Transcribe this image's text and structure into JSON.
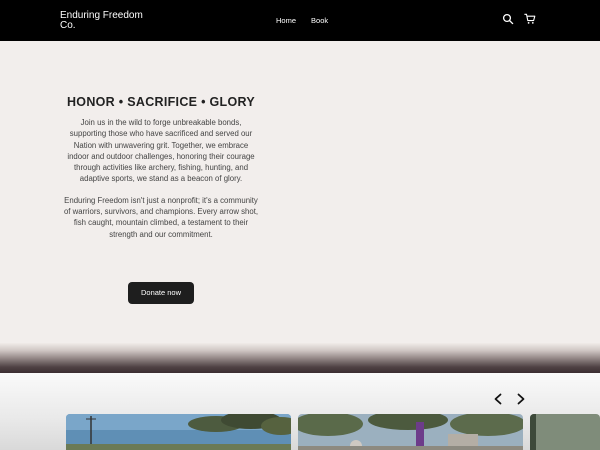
{
  "header": {
    "brand": "Enduring Freedom Co.",
    "nav": [
      {
        "label": "Home"
      },
      {
        "label": "Book"
      }
    ],
    "icons": [
      "search-icon",
      "cart-icon"
    ]
  },
  "hero": {
    "title": "HONOR • SACRIFICE • GLORY",
    "paragraphs": [
      "Join us in the wild to forge unbreakable bonds, supporting those who have sacrificed and served our Nation with unwavering grit. Together, we embrace indoor and outdoor challenges, honoring their courage through activities like archery, fishing, hunting, and adaptive sports, we stand as a beacon of glory.",
      "Enduring Freedom isn't just a nonprofit; it's a community of warriors, survivors, and champions. Every arrow shot, fish caught, mountain climbed, a testament to their strength and our commitment."
    ],
    "button": "Donate now"
  },
  "carousel": {
    "icons": [
      "chevron-left-icon",
      "chevron-right-icon"
    ]
  },
  "colors": {
    "header_bg": "#000000",
    "hero_bg": "#f2eeec",
    "button_bg": "#1e1e1e"
  }
}
